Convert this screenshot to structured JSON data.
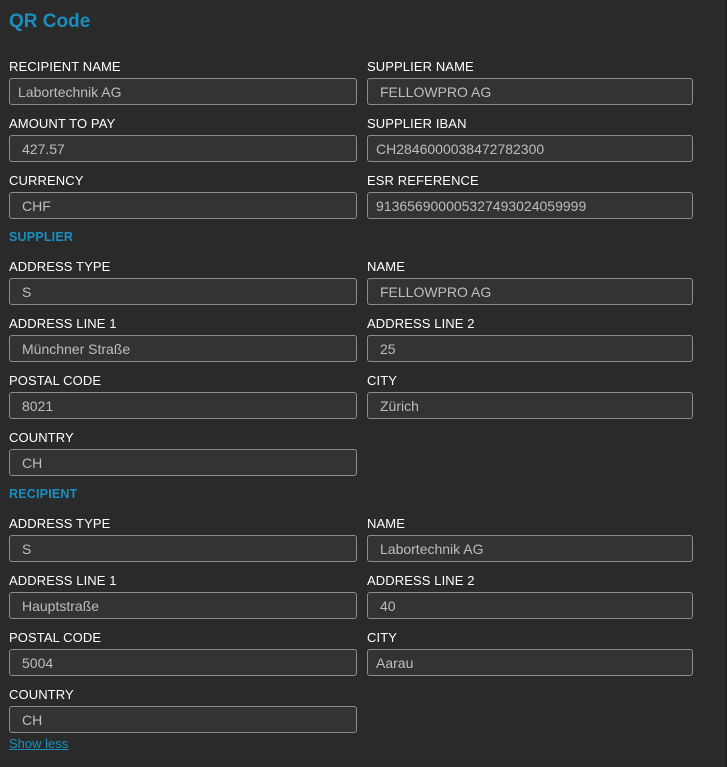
{
  "title": "QR Code",
  "main": {
    "recipient_name": {
      "label": "RECIPIENT NAME",
      "value": "Labortechnik AG"
    },
    "supplier_name": {
      "label": "SUPPLIER NAME",
      "value": "FELLOWPRO AG"
    },
    "amount_to_pay": {
      "label": "AMOUNT TO PAY",
      "value": "427.57"
    },
    "supplier_iban": {
      "label": "SUPPLIER IBAN",
      "value": "CH2846000038472782300"
    },
    "currency": {
      "label": "CURRENCY",
      "value": "CHF"
    },
    "esr_reference": {
      "label": "ESR REFERENCE",
      "value": "913656900005327493024059999"
    }
  },
  "supplier": {
    "heading": "SUPPLIER",
    "address_type": {
      "label": "ADDRESS TYPE",
      "value": "S"
    },
    "name": {
      "label": "NAME",
      "value": "FELLOWPRO AG"
    },
    "address_line_1": {
      "label": "ADDRESS LINE 1",
      "value": "Münchner Straße"
    },
    "address_line_2": {
      "label": "ADDRESS LINE 2",
      "value": "25"
    },
    "postal_code": {
      "label": "POSTAL CODE",
      "value": "8021"
    },
    "city": {
      "label": "CITY",
      "value": "Zürich"
    },
    "country": {
      "label": "COUNTRY",
      "value": "CH"
    }
  },
  "recipient": {
    "heading": "RECIPIENT",
    "address_type": {
      "label": "ADDRESS TYPE",
      "value": "S"
    },
    "name": {
      "label": "NAME",
      "value": "Labortechnik AG"
    },
    "address_line_1": {
      "label": "ADDRESS LINE 1",
      "value": "Hauptstraße"
    },
    "address_line_2": {
      "label": "ADDRESS LINE 2",
      "value": "40"
    },
    "postal_code": {
      "label": "POSTAL CODE",
      "value": "5004"
    },
    "city": {
      "label": "CITY",
      "value": "Aarau"
    },
    "country": {
      "label": "COUNTRY",
      "value": "CH"
    }
  },
  "show_less_label": "Show less",
  "colors": {
    "accent": "#1a8fbf",
    "background": "#2a2a2a",
    "input_border": "#8c8c8c",
    "input_text": "#bdbdbd"
  }
}
